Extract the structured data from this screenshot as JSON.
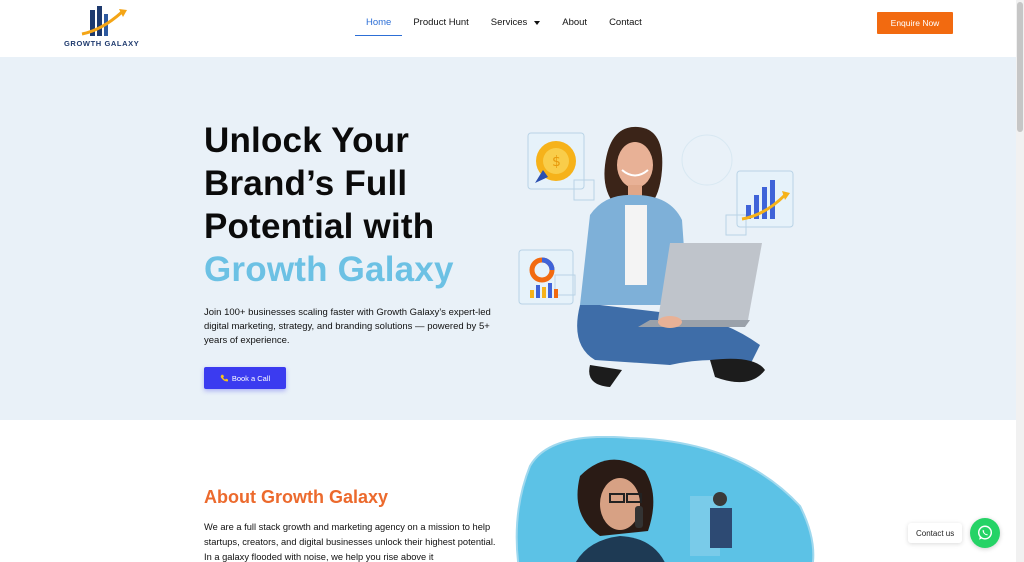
{
  "header": {
    "logo_text": "GROWTH GALAXY",
    "nav": [
      {
        "label": "Home",
        "active": true
      },
      {
        "label": "Product Hunt",
        "active": false
      },
      {
        "label": "Services",
        "active": false,
        "has_dropdown": true
      },
      {
        "label": "About",
        "active": false
      },
      {
        "label": "Contact",
        "active": false
      }
    ],
    "cta_label": "Enquire Now"
  },
  "hero": {
    "title_lines": [
      "Unlock Your",
      "Brand’s Full",
      "Potential with"
    ],
    "title_accent": "Growth Galaxy",
    "description": "Join 100+ businesses scaling faster with Growth Galaxy’s expert-led digital marketing, strategy, and branding solutions — powered by 5+ years of experience.",
    "button_label": "Book a Call",
    "button_icon": "phone-icon"
  },
  "about": {
    "title": "About Growth Galaxy",
    "text": "We are a full stack growth and marketing agency on a mission to help startups, creators, and digital businesses unlock their highest potential. In a galaxy flooded with noise, we help you rise above it"
  },
  "contact_widget": {
    "label": "Contact us",
    "icon": "whatsapp-icon"
  },
  "colors": {
    "accent_orange": "#f26a10",
    "accent_blue": "#2d6fd6",
    "hero_bg": "#e9f1f8",
    "title_accent": "#6cc1e4",
    "button_blue": "#3b3bf0",
    "about_title": "#ec6a2d",
    "whatsapp_green": "#25d366"
  }
}
